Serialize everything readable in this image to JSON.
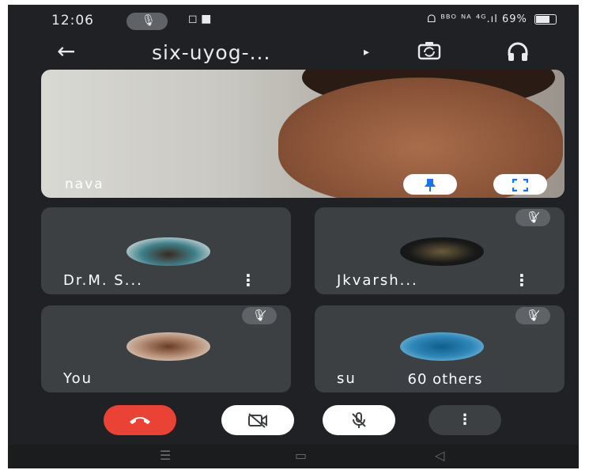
{
  "status_bar": {
    "time": "12:06",
    "right_text": "ᗝ ᴮᴮᴼ ᴺᴬ ⁴ᴳ.ıl 69%"
  },
  "top_bar": {
    "meeting_title": "six-uyog-...",
    "caret": "▸"
  },
  "main_tile": {
    "participant_name": "nava"
  },
  "tiles": [
    {
      "name": "Dr.M. S...",
      "more": "⋮",
      "muted": false
    },
    {
      "name": "Jkvarsh...",
      "more": "⋮",
      "muted": true
    },
    {
      "name": "You",
      "muted": true
    },
    {
      "name": "su",
      "others_label": "60 others",
      "muted": true
    }
  ],
  "controls": {
    "end_call": "end-call",
    "camera": "camera-off",
    "mic": "mic-off",
    "more": "⋮"
  },
  "colors": {
    "background": "#202124",
    "tile": "#3c4043",
    "end_call": "#ea4335",
    "accent": "#1a73e8"
  }
}
